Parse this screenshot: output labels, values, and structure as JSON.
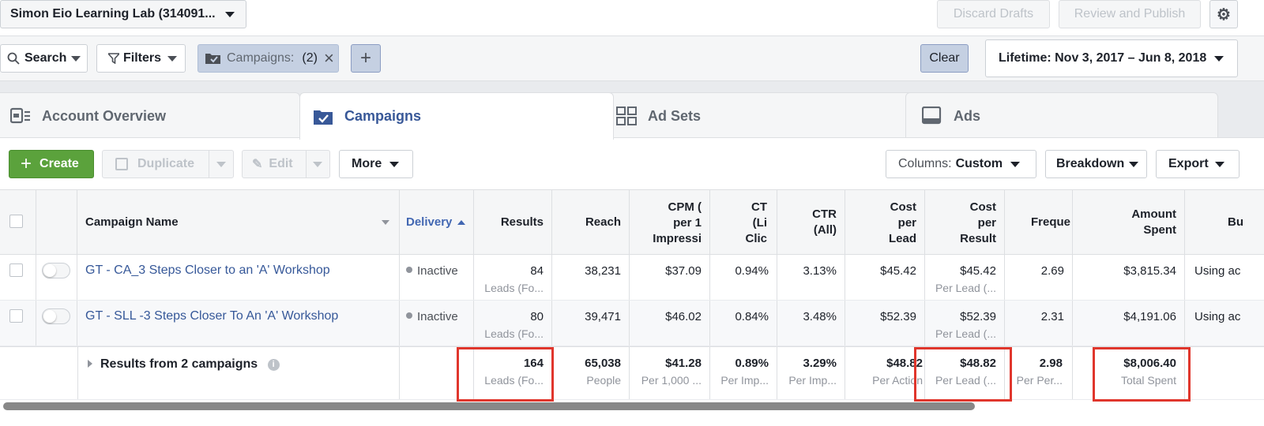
{
  "account": {
    "name": "Simon Eio Learning Lab (314091..."
  },
  "top_actions": {
    "discard": "Discard Drafts",
    "review": "Review and Publish"
  },
  "filterbar": {
    "search": "Search",
    "filters": "Filters",
    "chip_label": "Campaigns:",
    "chip_count": "(2)",
    "clear": "Clear",
    "date_range": "Lifetime: Nov 3, 2017 – Jun 8, 2018"
  },
  "tabs": [
    {
      "label": "Account Overview"
    },
    {
      "label": "Campaigns"
    },
    {
      "label": "Ad Sets"
    },
    {
      "label": "Ads"
    }
  ],
  "toolbar": {
    "create": "Create",
    "duplicate": "Duplicate",
    "edit": "Edit",
    "more": "More",
    "columns_prefix": "Columns:",
    "columns_value": "Custom",
    "breakdown": "Breakdown",
    "export": "Export"
  },
  "headers": {
    "campaign_name": "Campaign Name",
    "delivery": "Delivery",
    "results": "Results",
    "reach": "Reach",
    "cpm": [
      "CPM (",
      "per 1",
      "Impressi"
    ],
    "ctr_link": [
      "CT",
      "(Li",
      "Clic"
    ],
    "ctr_all": [
      "CTR",
      "(All)"
    ],
    "cost_per_lead": [
      "Cost",
      "per",
      "Lead"
    ],
    "cost_per_result": [
      "Cost",
      "per",
      "Result"
    ],
    "frequency": "Freque",
    "amount_spent": [
      "Amount",
      "Spent"
    ],
    "bid": "Bu"
  },
  "rows": [
    {
      "name": "GT - CA_3 Steps Closer to an 'A' Workshop",
      "delivery": "Inactive",
      "results": "84",
      "results_sub": "Leads (Fo...",
      "reach": "38,231",
      "cpm": "$37.09",
      "ctr_link": "0.94%",
      "ctr_all": "3.13%",
      "cost_per_lead": "$45.42",
      "cost_per_result": "$45.42",
      "cost_per_result_sub": "Per Lead (...",
      "frequency": "2.69",
      "amount_spent": "$3,815.34",
      "bid": "Using ac"
    },
    {
      "name": "GT - SLL -3 Steps Closer To An 'A' Workshop",
      "delivery": "Inactive",
      "results": "80",
      "results_sub": "Leads (Fo...",
      "reach": "39,471",
      "cpm": "$46.02",
      "ctr_link": "0.84%",
      "ctr_all": "3.48%",
      "cost_per_lead": "$52.39",
      "cost_per_result": "$52.39",
      "cost_per_result_sub": "Per Lead (...",
      "frequency": "2.31",
      "amount_spent": "$4,191.06",
      "bid": "Using ac"
    }
  ],
  "totals": {
    "label": "Results from 2 campaigns",
    "results": "164",
    "results_sub": "Leads (Fo...",
    "reach": "65,038",
    "reach_sub": "People",
    "cpm": "$41.28",
    "cpm_sub": "Per 1,000 ...",
    "ctr_link": "0.89%",
    "ctr_link_sub": "Per Imp...",
    "ctr_all": "3.29%",
    "ctr_all_sub": "Per Imp...",
    "cost_per_lead": "$48.82",
    "cost_per_lead_sub": "Per Action",
    "cost_per_result": "$48.82",
    "cost_per_result_sub": "Per Lead (...",
    "frequency": "2.98",
    "frequency_sub": "Per Per...",
    "amount_spent": "$8,006.40",
    "amount_spent_sub": "Total Spent"
  },
  "colors": {
    "accent": "#385898",
    "create_green": "#5ba23c",
    "highlight_red": "#e0362c",
    "status_grey": "#90949c"
  }
}
